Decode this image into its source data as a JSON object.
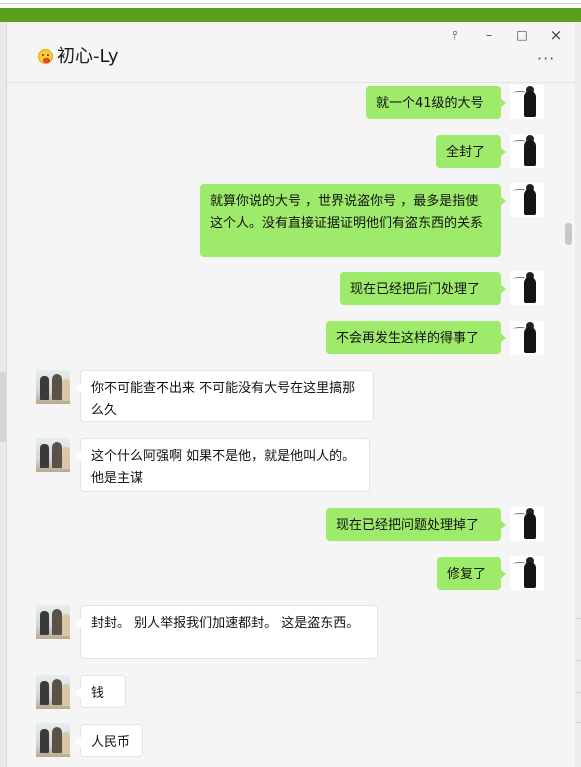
{
  "window": {
    "contact_name": "初心-Ly",
    "controls": {
      "pin": "a",
      "minimize": "–",
      "maximize": "□",
      "close": "×"
    },
    "more": "···"
  },
  "colors": {
    "me_bubble": "#9eea6a",
    "other_bubble": "#ffffff",
    "accent": "#5a9e1c"
  },
  "messages": [
    {
      "sender": "me",
      "text": "就一个41级的大号"
    },
    {
      "sender": "me",
      "text": "全封了"
    },
    {
      "sender": "me",
      "text": "就算你说的大号 ，世界说盗你号 ，最多是指使这个人。没有直接证据证明他们有盗东西的关系"
    },
    {
      "sender": "me",
      "text": "现在已经把后门处理了"
    },
    {
      "sender": "me",
      "text": "不会再发生这样的得事了"
    },
    {
      "sender": "other",
      "text": "你不可能查不出来  不可能没有大号在这里搞那么久"
    },
    {
      "sender": "other",
      "text": "这个什么阿强啊 如果不是他，就是他叫人的。 他是主谋"
    },
    {
      "sender": "me",
      "text": "现在已经把问题处理掉了"
    },
    {
      "sender": "me",
      "text": "修复了"
    },
    {
      "sender": "other",
      "text": "封封。  别人举报我们加速都封。  这是盗东西。"
    },
    {
      "sender": "other",
      "text": "钱"
    },
    {
      "sender": "other",
      "text": "人民币"
    }
  ]
}
